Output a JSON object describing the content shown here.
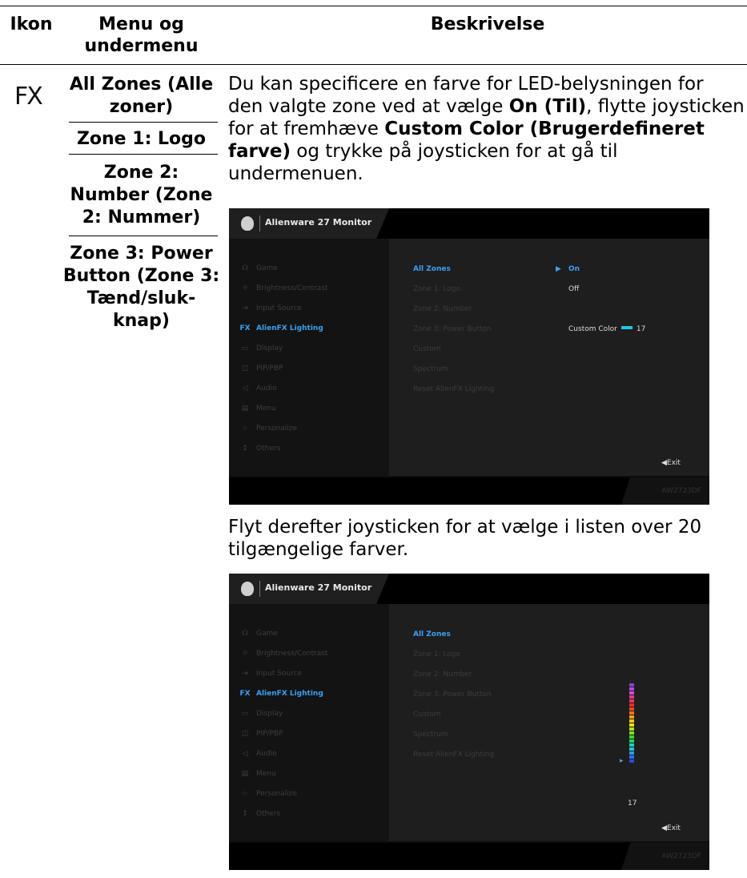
{
  "table": {
    "headers": {
      "icon": "Ikon",
      "menu_line1": "Menu og",
      "menu_line2": "undermenu",
      "description": "Beskrivelse"
    },
    "row_icon": "FX",
    "menu_items": {
      "all_zones_1": "All Zones (Alle",
      "all_zones_2": "zoner)",
      "zone1": "Zone 1: Logo",
      "zone2_1": "Zone 2:",
      "zone2_2": "Number (Zone",
      "zone2_3": "2: Nummer)",
      "zone3_1": "Zone 3: Power",
      "zone3_2": "Button (Zone 3:",
      "zone3_3": "Tænd/sluk-",
      "zone3_4": "knap)"
    },
    "description": {
      "p1_l1": "Du kan specificere en farve for LED-belysningen for",
      "p1_l2": "den valgte zone ved at vælge ",
      "p1_l2_b": "On (Til)",
      "p1_l2_e": ", flytte joysticken",
      "p1_l3": "for at fremhæve ",
      "p1_l3_b": "Custom Color (Brugerdefineret",
      "p1_l4_b": "farve)",
      "p1_l4": " og trykke på joysticken for at gå til",
      "p1_l5": "undermenuen.",
      "p2_l1": "Flyt derefter joysticken for at vælge i listen over 20",
      "p2_l2": "tilgængelige farver."
    }
  },
  "osd": {
    "title": "Alienware 27 Monitor",
    "model": "AW2723DF",
    "exit": "◀Exit",
    "menu": [
      {
        "icon": "☊",
        "label": "Game"
      },
      {
        "icon": "☼",
        "label": "Brightness/Contrast"
      },
      {
        "icon": "⇥",
        "label": "Input Source"
      },
      {
        "icon": "FX",
        "label": "AlienFX Lighting"
      },
      {
        "icon": "▭",
        "label": "Display"
      },
      {
        "icon": "◫",
        "label": "PIP/PBP"
      },
      {
        "icon": "◁",
        "label": "Audio"
      },
      {
        "icon": "▤",
        "label": "Menu"
      },
      {
        "icon": "☆",
        "label": "Personalize"
      },
      {
        "icon": "↕",
        "label": "Others"
      }
    ],
    "submenu": [
      "All Zones",
      "Zone 1: Logo",
      "Zone 2: Number",
      "Zone 3: Power Button",
      "Custom",
      "Spectrum",
      "Reset AlienFX Lighting"
    ],
    "values": {
      "on": "On",
      "off": "Off",
      "custom_color": "Custom Color",
      "color_index": "17"
    },
    "on_marker": "▶",
    "picker_marker": "▸",
    "colors": [
      "#222222",
      "#8a3fd6",
      "#b04be0",
      "#d44fc8",
      "#e6389c",
      "#ee3062",
      "#ee2b2b",
      "#f04a1e",
      "#f2761a",
      "#f4a21a",
      "#f4c81a",
      "#e8e41a",
      "#b8e41a",
      "#7ee01a",
      "#3cd82a",
      "#26d06a",
      "#22d0ae",
      "#22c4e0",
      "#2a9ce8",
      "#2a72ec",
      "#2a48ee"
    ],
    "accent": "#3aa1f4"
  }
}
